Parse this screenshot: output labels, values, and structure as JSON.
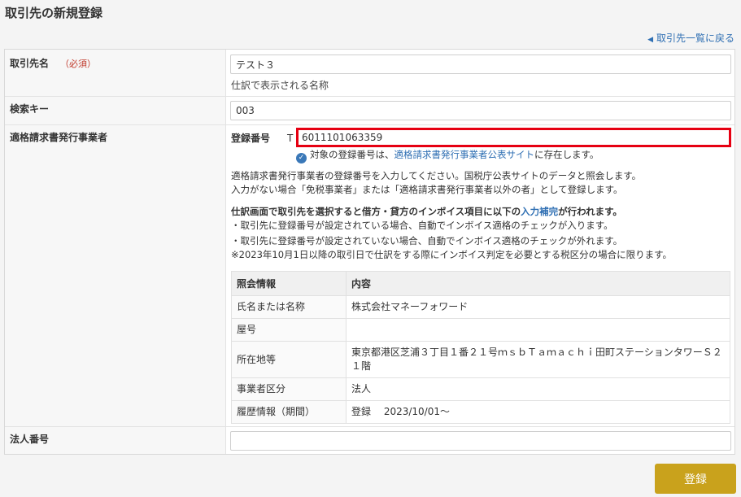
{
  "page": {
    "title": "取引先の新規登録",
    "back_link": "取引先一覧に戻る"
  },
  "form": {
    "name": {
      "label": "取引先名",
      "required": "（必須）",
      "value": "テスト３",
      "hint": "仕訳で表示される名称"
    },
    "search_key": {
      "label": "検索キー",
      "value": "003"
    },
    "invoice_issuer": {
      "label": "適格請求書発行事業者",
      "reg_label": "登録番号",
      "prefix": "T",
      "reg_value": "6011101063359",
      "status_pre": "対象の登録番号は、",
      "status_link": "適格請求書発行事業者公表サイト",
      "status_post": "に存在します。",
      "desc1": "適格請求書発行事業者の登録番号を入力してください。国税庁公表サイトのデータと照会します。",
      "desc2": "入力がない場合「免税事業者」または「適格請求書発行事業者以外の者」として登録します。",
      "note_pre": "仕訳画面で取引先を選択すると借方・貸方のインボイス項目に以下の",
      "note_link": "入力補完",
      "note_post": "が行われます。",
      "bullet1": "・取引先に登録番号が設定されている場合、自動でインボイス適格のチェックが入ります。",
      "bullet2": "・取引先に登録番号が設定されていない場合、自動でインボイス適格のチェックが外れます。",
      "footnote": "※2023年10月1日以降の取引日で仕訳をする際にインボイス判定を必要とする税区分の場合に限ります。",
      "table": {
        "headers": [
          "照会情報",
          "内容"
        ],
        "rows": [
          {
            "k": "氏名または名称",
            "v": "株式会社マネーフォワード"
          },
          {
            "k": "屋号",
            "v": ""
          },
          {
            "k": "所在地等",
            "v": "東京都港区芝浦３丁目１番２１号ｍｓｂＴａｍａｃｈｉ田町ステーションタワーＳ２１階"
          },
          {
            "k": "事業者区分",
            "v": "法人"
          },
          {
            "k": "履歴情報（期間）",
            "v": "登録　 2023/10/01～"
          }
        ]
      }
    },
    "corp_number": {
      "label": "法人番号",
      "value": ""
    }
  },
  "submit_label": "登録",
  "colors": {
    "accent": "#c9a21c",
    "link": "#2f6fb3",
    "highlight": "#e60012"
  }
}
